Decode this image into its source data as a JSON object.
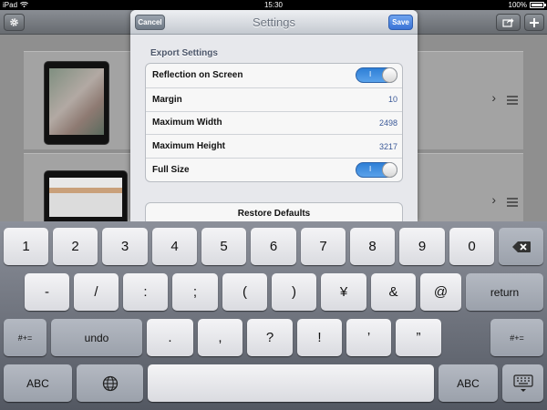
{
  "status": {
    "device": "iPad",
    "time": "15:30",
    "battery": "100%",
    "battery_level": 1.0
  },
  "modal": {
    "title": "Settings",
    "cancel_label": "Cancel",
    "save_label": "Save",
    "section_title": "Export Settings",
    "rows": [
      {
        "label": "Reflection on Screen",
        "type": "switch",
        "switch_text": "I",
        "on": true
      },
      {
        "label": "Margin",
        "type": "value",
        "value": "10"
      },
      {
        "label": "Maximum Width",
        "type": "value",
        "value": "2498"
      },
      {
        "label": "Maximum Height",
        "type": "value",
        "value": "3217"
      },
      {
        "label": "Full Size",
        "type": "switch",
        "switch_text": "I",
        "on": true
      }
    ],
    "restore_label": "Restore Defaults"
  },
  "keyboard": {
    "row1": [
      "1",
      "2",
      "3",
      "4",
      "5",
      "6",
      "7",
      "8",
      "9",
      "0"
    ],
    "row2": [
      "-",
      "/",
      ":",
      ";",
      "(",
      ")",
      "¥",
      "&",
      "@"
    ],
    "return_label": "return",
    "row3_left": "#+=",
    "undo_label": "undo",
    "row3": [
      ".",
      ",",
      "?",
      "!",
      "’",
      "”"
    ],
    "row3_right": "#+=",
    "abc_left": "ABC",
    "abc_right": "ABC"
  },
  "colors": {
    "accent": "#3a73d6",
    "switch_on": "#2e7fd6",
    "value_text": "#3b5998"
  },
  "icons": [
    "wifi-icon",
    "battery-icon",
    "gear-icon",
    "share-icon",
    "plus-icon",
    "chevron-right-icon",
    "grip-icon",
    "backspace-icon",
    "globe-icon",
    "keyboard-dismiss-icon"
  ]
}
